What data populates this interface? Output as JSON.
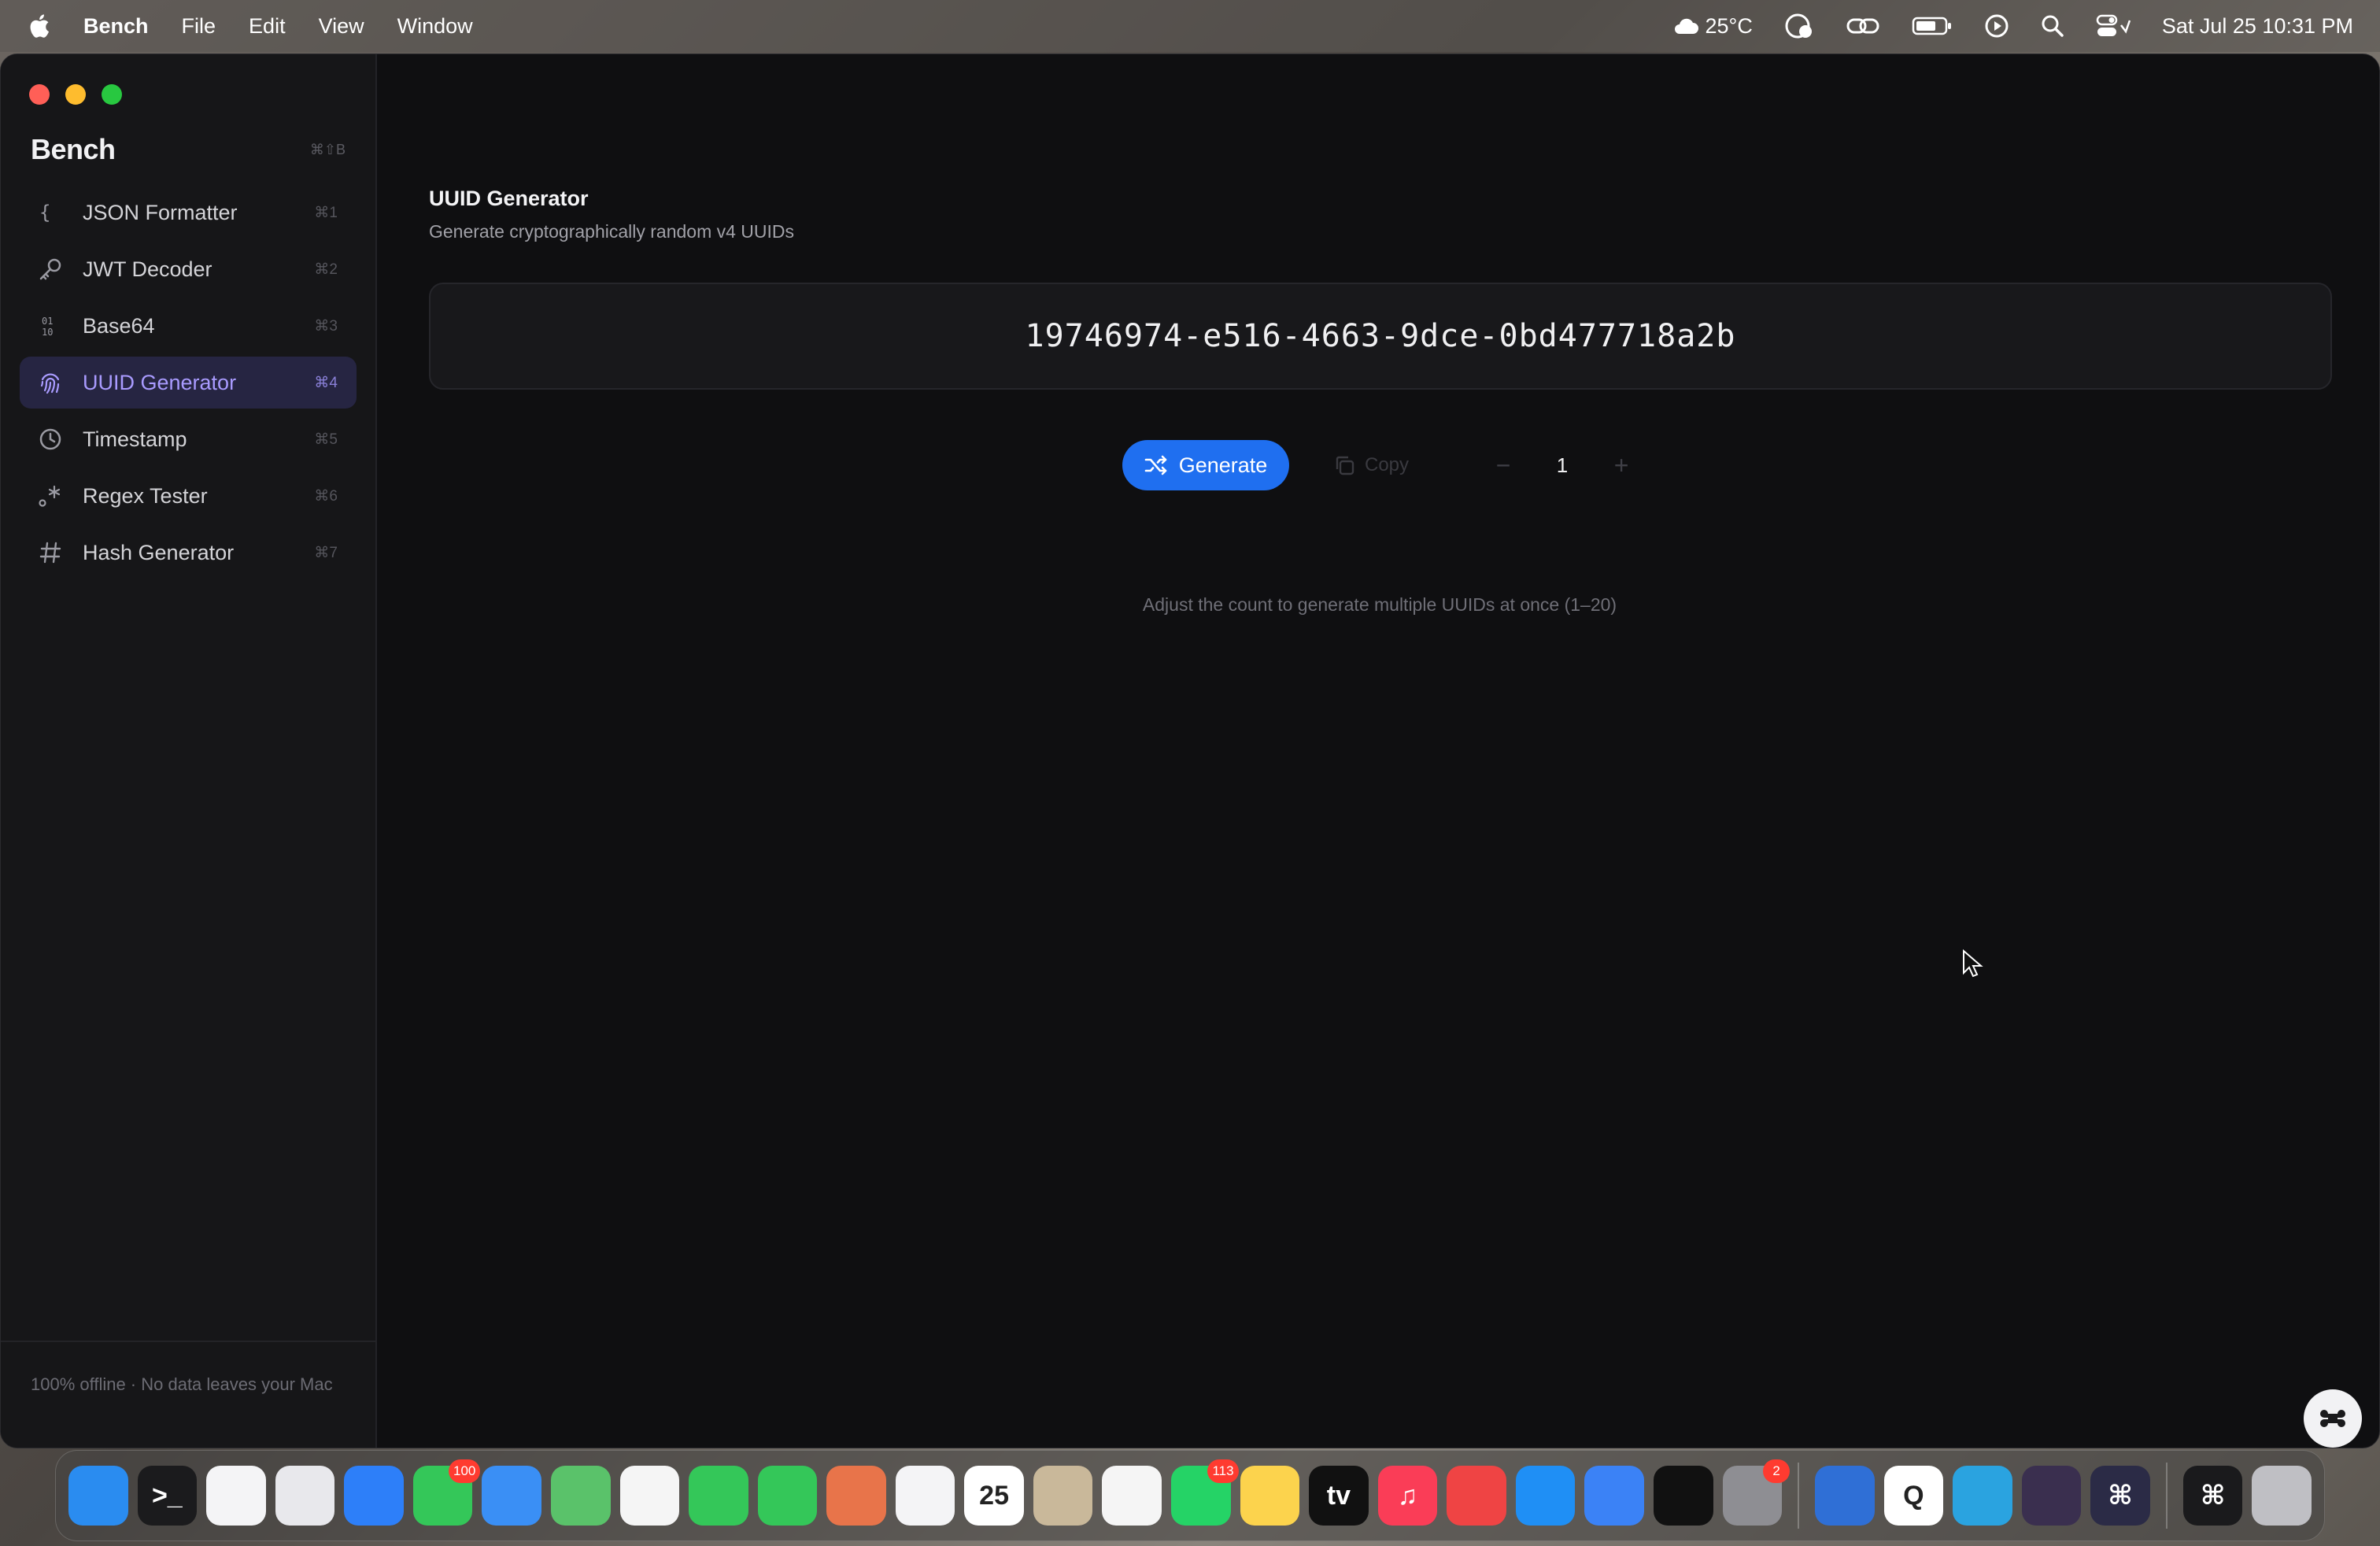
{
  "menubar": {
    "app_name": "Bench",
    "menus": [
      "File",
      "Edit",
      "View",
      "Window"
    ],
    "weather": "25°C",
    "datetime": "Sat Jul 25  10:31 PM"
  },
  "sidebar": {
    "title": "Bench",
    "title_shortcut": "⌘⇧B",
    "items": [
      {
        "label": "JSON Formatter",
        "shortcut": "⌘1",
        "icon": "braces-icon"
      },
      {
        "label": "JWT Decoder",
        "shortcut": "⌘2",
        "icon": "key-icon"
      },
      {
        "label": "Base64",
        "shortcut": "⌘3",
        "icon": "binary-icon"
      },
      {
        "label": "UUID Generator",
        "shortcut": "⌘4",
        "icon": "fingerprint-icon",
        "active": true
      },
      {
        "label": "Timestamp",
        "shortcut": "⌘5",
        "icon": "clock-icon"
      },
      {
        "label": "Regex Tester",
        "shortcut": "⌘6",
        "icon": "regex-icon"
      },
      {
        "label": "Hash Generator",
        "shortcut": "⌘7",
        "icon": "hash-icon"
      }
    ],
    "footer": "100% offline · No data leaves your Mac"
  },
  "main": {
    "title": "UUID Generator",
    "subtitle": "Generate cryptographically random v4 UUIDs",
    "uuid": "19746974-e516-4663-9dce-0bd477718a2b",
    "generate_label": "Generate",
    "copy_label": "Copy",
    "decrement_label": "−",
    "increment_label": "+",
    "count": "1",
    "hint": "Adjust the count to generate multiple UUIDs at once (1–20)"
  },
  "dock": {
    "apps": [
      {
        "name": "finder-icon",
        "color": "#2a8cf0",
        "glyph": ""
      },
      {
        "name": "terminal-icon",
        "color": "#1b1b1d",
        "glyph": ">_"
      },
      {
        "name": "vscode-icon",
        "color": "#f4f4f6",
        "glyph": ""
      },
      {
        "name": "launchpad-icon",
        "color": "#e8e8ec",
        "glyph": ""
      },
      {
        "name": "safari-icon",
        "color": "#2d7ff9",
        "glyph": ""
      },
      {
        "name": "messages-icon",
        "color": "#34c759",
        "glyph": "",
        "badge": "100"
      },
      {
        "name": "mail-icon",
        "color": "#3a8ff5",
        "glyph": ""
      },
      {
        "name": "maps-icon",
        "color": "#5ac26a",
        "glyph": ""
      },
      {
        "name": "photos-icon",
        "color": "#f5f5f5",
        "glyph": ""
      },
      {
        "name": "facetime-icon",
        "color": "#34c759",
        "glyph": ""
      },
      {
        "name": "phone-icon",
        "color": "#34c759",
        "glyph": ""
      },
      {
        "name": "claude-icon",
        "color": "#e8744a",
        "glyph": ""
      },
      {
        "name": "chrome-icon",
        "color": "#f4f4f6",
        "glyph": ""
      },
      {
        "name": "calendar-icon",
        "color": "#ffffff",
        "glyph": "25"
      },
      {
        "name": "contacts-icon",
        "color": "#c9b89a",
        "glyph": ""
      },
      {
        "name": "reminders-icon",
        "color": "#f5f5f5",
        "glyph": ""
      },
      {
        "name": "whatsapp-icon",
        "color": "#25d366",
        "glyph": "",
        "badge": "113"
      },
      {
        "name": "notes-icon",
        "color": "#fcd34d",
        "glyph": ""
      },
      {
        "name": "appletv-icon",
        "color": "#111111",
        "glyph": "tv"
      },
      {
        "name": "music-icon",
        "color": "#fa3d57",
        "glyph": "♫"
      },
      {
        "name": "rocket-icon",
        "color": "#ef4444",
        "glyph": ""
      },
      {
        "name": "appstore-icon",
        "color": "#1f8ff5",
        "glyph": ""
      },
      {
        "name": "simulator-icon",
        "color": "#3b82f6",
        "glyph": ""
      },
      {
        "name": "spotify-icon",
        "color": "#111111",
        "glyph": ""
      },
      {
        "name": "settings-icon",
        "color": "#8e8e93",
        "glyph": "",
        "badge": "2"
      },
      {
        "name": "docker-icon",
        "color": "#2f6fd6",
        "glyph": ""
      },
      {
        "name": "quicktime-icon",
        "color": "#ffffff",
        "glyph": "Q"
      },
      {
        "name": "telegram-icon",
        "color": "#2aa3e0",
        "glyph": ""
      },
      {
        "name": "game-icon",
        "color": "#3a2f4f",
        "glyph": ""
      },
      {
        "name": "command-icon",
        "color": "#2b2b46",
        "glyph": "⌘"
      },
      {
        "name": "bench-app-icon",
        "color": "#1a1a1c",
        "glyph": "⌘"
      },
      {
        "name": "trash-icon",
        "color": "#bfbfc4",
        "glyph": ""
      }
    ]
  }
}
